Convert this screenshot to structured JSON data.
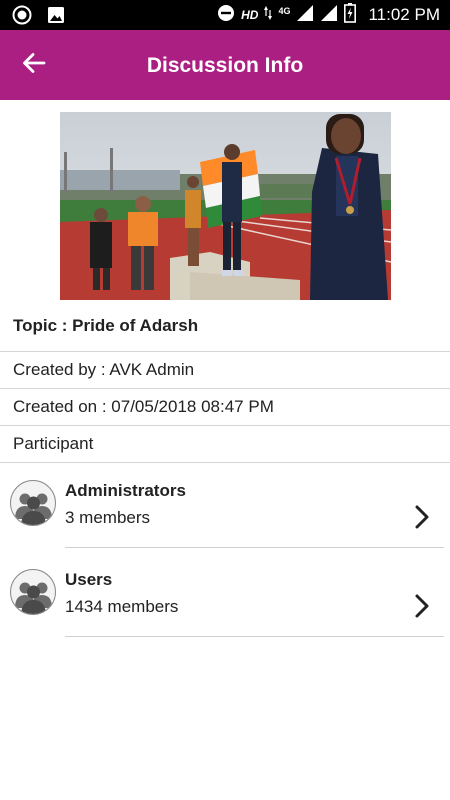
{
  "status_bar": {
    "time": "11:02 PM",
    "network_hd": "HD",
    "network_type": "4G",
    "icons": [
      "record-icon",
      "image-icon",
      "do-not-disturb-icon",
      "signal-icon",
      "battery-icon"
    ]
  },
  "header": {
    "title": "Discussion Info",
    "back_icon": "arrow-left-icon",
    "background": "#ab1f83"
  },
  "discussion": {
    "topic": "Topic : Pride of Adarsh",
    "created_by": "Created by : AVK Admin",
    "created_on": "Created on : 07/05/2018 08:47 PM",
    "participant_label": "Participant"
  },
  "groups": [
    {
      "name": "Administrators",
      "members": "3 members"
    },
    {
      "name": "Users",
      "members": "1434 members"
    }
  ]
}
